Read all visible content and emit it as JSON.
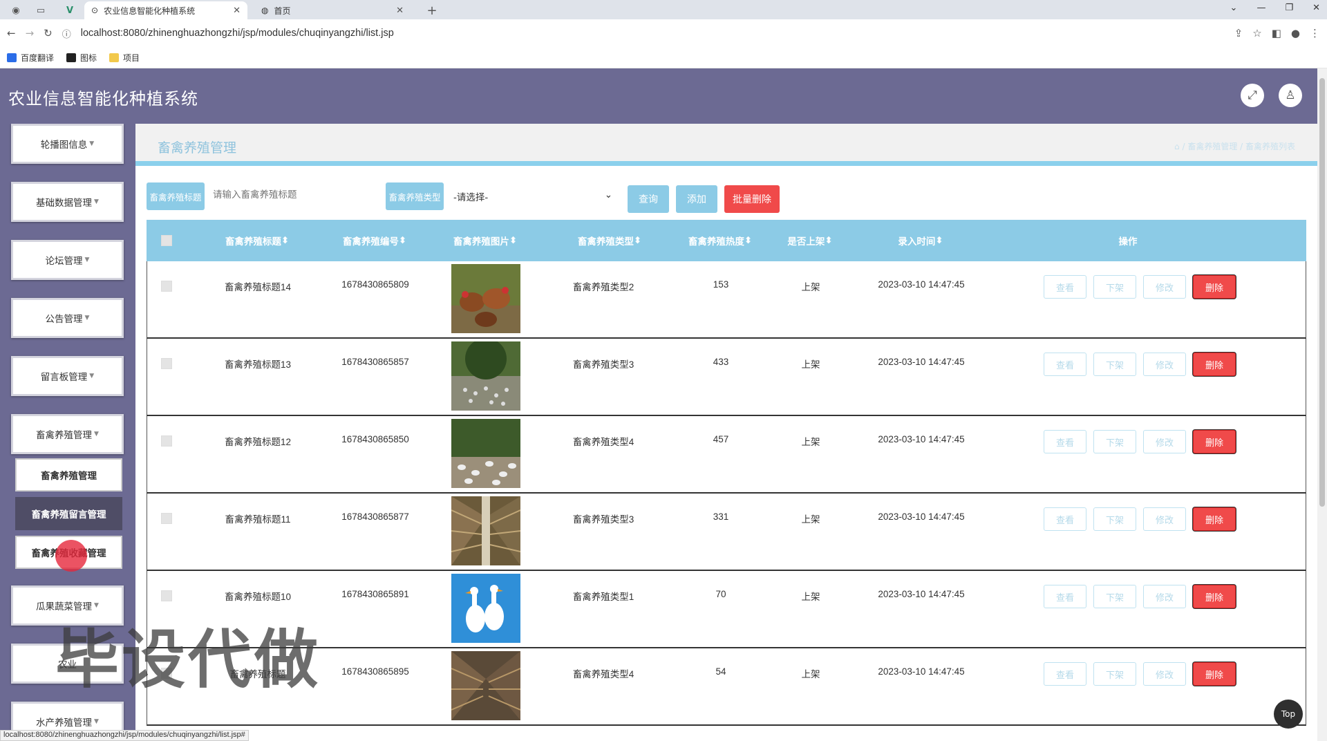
{
  "browser": {
    "tabs": [
      {
        "title": "农业信息智能化种植系统",
        "active": true
      },
      {
        "title": "首页",
        "active": false
      }
    ],
    "url": "localhost:8080/zhinenghuazhongzhi/jsp/modules/chuqinyangzhi/list.jsp",
    "bookmarks": [
      "百度翻译",
      "图标",
      "项目"
    ],
    "status_url": "localhost:8080/zhinenghuazhongzhi/jsp/modules/chuqinyangzhi/list.jsp#"
  },
  "header": {
    "title": "农业信息智能化种植系统"
  },
  "sidebar": {
    "items": [
      "轮播图信息",
      "基础数据管理",
      "论坛管理",
      "公告管理",
      "留言板管理",
      "畜禽养殖管理",
      "瓜果蔬菜管理",
      "农业",
      "水产养殖管理"
    ],
    "submenu": [
      "畜禽养殖管理",
      "畜禽养殖留言管理",
      "畜禽养殖收藏管理"
    ]
  },
  "page": {
    "title": "畜禽养殖管理",
    "breadcrumb": "/ 畜禽养殖管理 / 畜禽养殖列表"
  },
  "search": {
    "title_label": "畜禽养殖标题",
    "title_placeholder": "请输入畜禽养殖标题",
    "type_label": "畜禽养殖类型",
    "type_selected": "-请选择-",
    "query_button": "查询",
    "add_button": "添加",
    "batch_delete_button": "批量删除"
  },
  "table": {
    "columns": [
      "畜禽养殖标题",
      "畜禽养殖编号",
      "畜禽养殖图片",
      "畜禽养殖类型",
      "畜禽养殖热度",
      "是否上架",
      "录入时间",
      "操作"
    ],
    "actions": [
      "查看",
      "下架",
      "修改",
      "删除"
    ],
    "rows": [
      {
        "title": "畜禽养殖标题14",
        "code": "1678430865809",
        "image": "chickens",
        "type": "畜禽养殖类型2",
        "heat": "153",
        "status": "上架",
        "time": "2023-03-10 14:47:45"
      },
      {
        "title": "畜禽养殖标题13",
        "code": "1678430865857",
        "image": "ducks-field",
        "type": "畜禽养殖类型3",
        "heat": "433",
        "status": "上架",
        "time": "2023-03-10 14:47:45"
      },
      {
        "title": "畜禽养殖标题12",
        "code": "1678430865850",
        "image": "ducks-pen",
        "type": "畜禽养殖类型4",
        "heat": "457",
        "status": "上架",
        "time": "2023-03-10 14:47:45"
      },
      {
        "title": "畜禽养殖标题11",
        "code": "1678430865877",
        "image": "chicken-cages",
        "type": "畜禽养殖类型3",
        "heat": "331",
        "status": "上架",
        "time": "2023-03-10 14:47:45"
      },
      {
        "title": "畜禽养殖标题10",
        "code": "1678430865891",
        "image": "white-geese",
        "type": "畜禽养殖类型1",
        "heat": "70",
        "status": "上架",
        "time": "2023-03-10 14:47:45"
      },
      {
        "title": "畜禽养殖标题",
        "code": "1678430865895",
        "image": "battery-cages",
        "type": "畜禽养殖类型4",
        "heat": "54",
        "status": "上架",
        "time": "2023-03-10 14:47:45"
      }
    ]
  },
  "watermark": "毕设代做",
  "top_button": "Top"
}
